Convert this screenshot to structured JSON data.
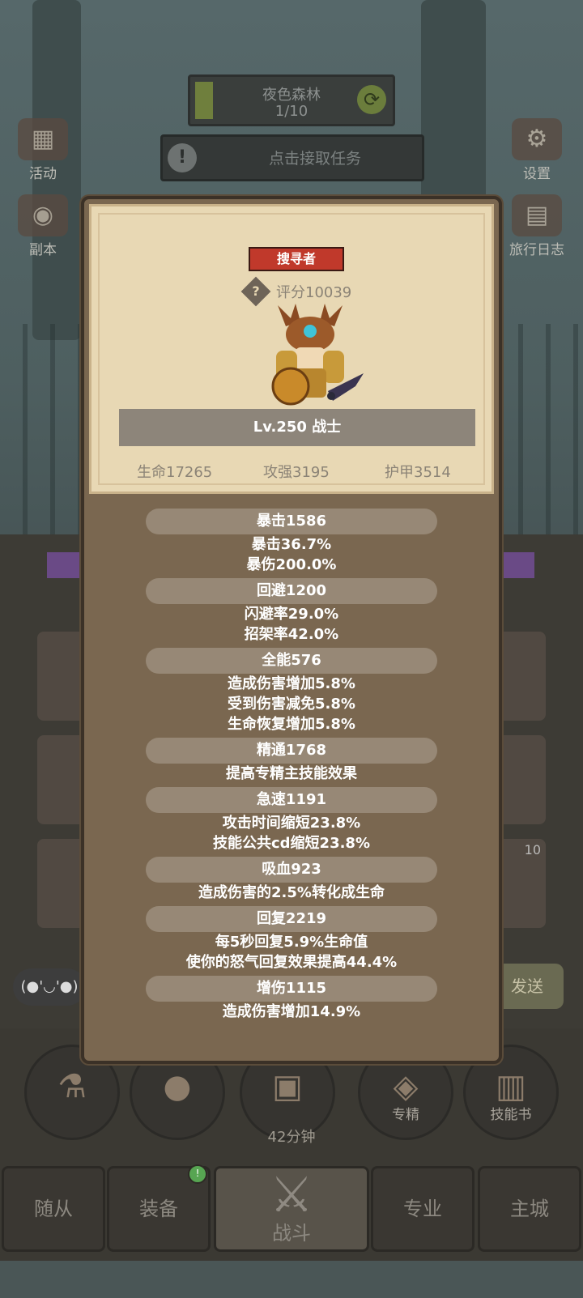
{
  "header": {
    "zone_name": "夜色森林",
    "zone_progress": "1/10",
    "task_prompt": "点击接取任务"
  },
  "side_menu": {
    "left": [
      "活动",
      "副本"
    ],
    "right": [
      "设置",
      "旅行日志"
    ]
  },
  "chat": {
    "emote": "(●'◡'●)",
    "send_label": "发送"
  },
  "action_buttons": [
    {
      "label": ""
    },
    {
      "label": ""
    },
    {
      "label": "42分钟"
    },
    {
      "label": "专精"
    },
    {
      "label": "技能书"
    }
  ],
  "slot_badge": "10",
  "tabs": [
    "随从",
    "装备",
    "战斗",
    "专业",
    "主城"
  ],
  "character": {
    "role": "搜寻者",
    "score": "评分10039",
    "level_class": "Lv.250 战士",
    "stats": [
      "生命17265",
      "攻强3195",
      "护甲3514"
    ]
  },
  "attributes": [
    {
      "name": "暴击1586",
      "effects": [
        "暴击36.7%",
        "暴伤200.0%"
      ]
    },
    {
      "name": "回避1200",
      "effects": [
        "闪避率29.0%",
        "招架率42.0%"
      ]
    },
    {
      "name": "全能576",
      "effects": [
        "造成伤害增加5.8%",
        "受到伤害减免5.8%",
        "生命恢复增加5.8%"
      ]
    },
    {
      "name": "精通1768",
      "effects": [
        "提高专精主技能效果"
      ]
    },
    {
      "name": "急速1191",
      "effects": [
        "攻击时间缩短23.8%",
        "技能公共cd缩短23.8%"
      ]
    },
    {
      "name": "吸血923",
      "effects": [
        "造成伤害的2.5%转化成生命"
      ]
    },
    {
      "name": "回复2219",
      "effects": [
        "每5秒回复5.9%生命值",
        "使你的怒气回复效果提高44.4%"
      ]
    },
    {
      "name": "增伤1115",
      "effects": [
        "造成伤害增加14.9%"
      ]
    }
  ]
}
